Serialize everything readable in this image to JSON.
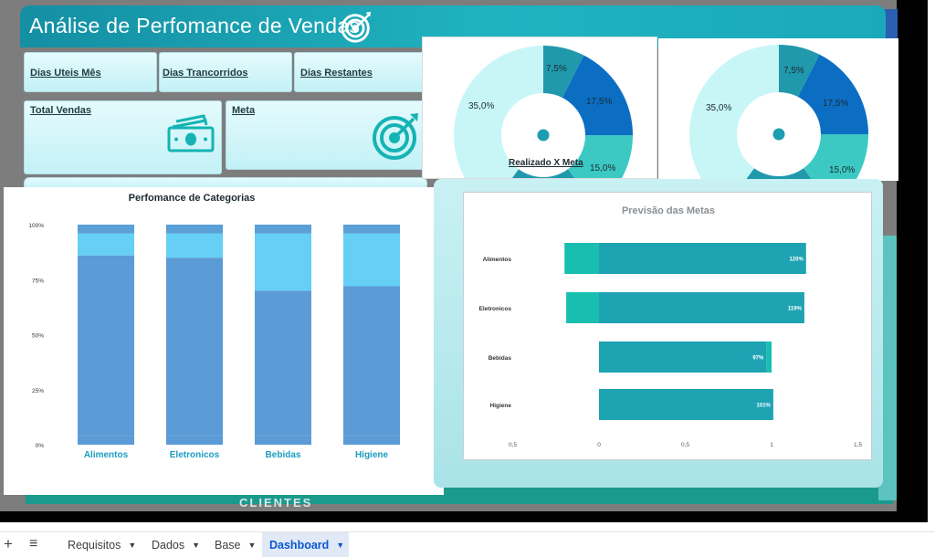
{
  "dashboard": {
    "title": "Análise de Perfomance de Vendas",
    "hidden_text": "CLIENTES"
  },
  "kpi": {
    "dias_uteis": "Dias Uteis Mês",
    "dias_trancorridos": "Dias Trancorridos",
    "dias_restantes": "Dias Restantes",
    "total_vendas": "Total Vendas",
    "meta": "Meta"
  },
  "icons": [
    "target-icon",
    "money-icon",
    "target-icon"
  ],
  "colors": {
    "banner": "#1aa9ba",
    "donut_light": "#c8f6f7",
    "donut_teal_dark": "#2199ad",
    "donut_blue": "#0b6ec3",
    "donut_teal": "#3cc9c4",
    "bar_blue": "#5b9bd6",
    "bar_light_blue": "#65cff5",
    "bar_top": "#5a9fd6",
    "forecast_bar": "#1ea3b3",
    "forecast_neg": "#18bfb0",
    "category_label": "#1a9cc0",
    "active_tab": "#0b57d0"
  },
  "donut_left": {
    "title": "Realizado X Meta",
    "labels": {
      "a": "7,5%",
      "b": "17,5%",
      "c": "15,0%",
      "d": "35,0%"
    }
  },
  "donut_right": {
    "labels": {
      "a": "7,5%",
      "b": "17,5%",
      "c": "15,0%",
      "d": "35,0%"
    }
  },
  "chart_data": [
    {
      "type": "bar",
      "stacked": true,
      "title": "Perfomance de Categorias",
      "categories": [
        "Alimentos",
        "Eletronicos",
        "Bebidas",
        "Higiene"
      ],
      "yticks": [
        "0%",
        "25%",
        "50%",
        "75%",
        "100%"
      ],
      "ylim": [
        0,
        100
      ],
      "series": [
        {
          "values": [
            86,
            85,
            70,
            72
          ],
          "color": "#5b9bd6"
        },
        {
          "values": [
            10,
            11,
            26,
            24
          ],
          "color": "#65cff5"
        },
        {
          "values": [
            4,
            4,
            4,
            4
          ],
          "color": "#5a9fd6"
        }
      ]
    },
    {
      "type": "bar",
      "orientation": "horizontal",
      "title": "Previsão das Metas",
      "categories": [
        "Alimentos",
        "Eletronicos",
        "Bebidas",
        "Higiene"
      ],
      "values": [
        1.2,
        1.19,
        0.97,
        1.01
      ],
      "negative_part": [
        -0.2,
        -0.19,
        0,
        0
      ],
      "data_labels": [
        "120%",
        "119%",
        "97%",
        "101%"
      ],
      "xticks": [
        "0,5",
        "0",
        "0,5",
        "1",
        "1,5"
      ],
      "xlim": [
        -0.5,
        1.5
      ]
    }
  ],
  "tabs": {
    "add_label": "+",
    "menu_label": "≡",
    "sheets": [
      {
        "label": "Requisitos",
        "active": false
      },
      {
        "label": "Dados",
        "active": false
      },
      {
        "label": "Base",
        "active": false
      },
      {
        "label": "Dashboard",
        "active": true
      }
    ],
    "caret": "▼"
  }
}
